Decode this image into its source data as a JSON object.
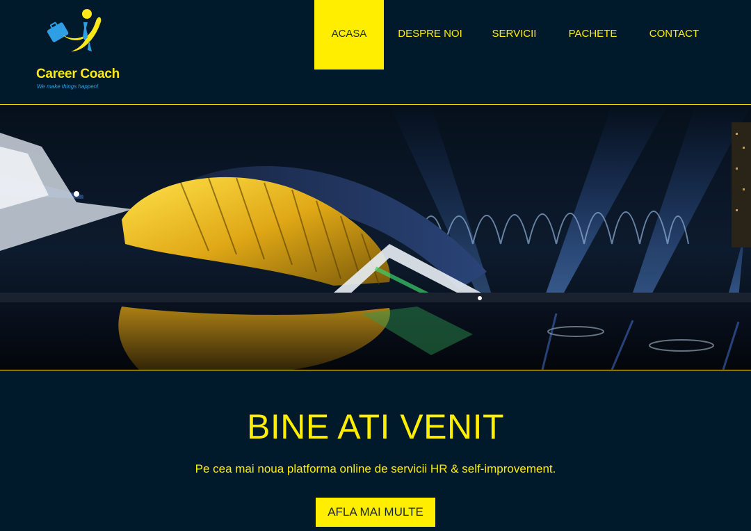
{
  "brand": {
    "name": "Career Coach",
    "tagline": "We make things happen!"
  },
  "nav": {
    "items": [
      {
        "label": "ACASA",
        "active": true
      },
      {
        "label": "DESPRE NOI",
        "active": false
      },
      {
        "label": "SERVICII",
        "active": false
      },
      {
        "label": "PACHETE",
        "active": false
      },
      {
        "label": "CONTACT",
        "active": false
      }
    ]
  },
  "hero": {
    "image": "night-architecture-city-of-arts-and-sciences"
  },
  "welcome": {
    "title": "BINE ATI VENIT",
    "subtitle": "Pe cea mai noua platforma online de servicii HR & self-improvement.",
    "cta_label": "AFLA MAI MULTE"
  },
  "colors": {
    "background": "#00192b",
    "accent": "#ffee00",
    "logo_blue": "#2ea3e6"
  }
}
